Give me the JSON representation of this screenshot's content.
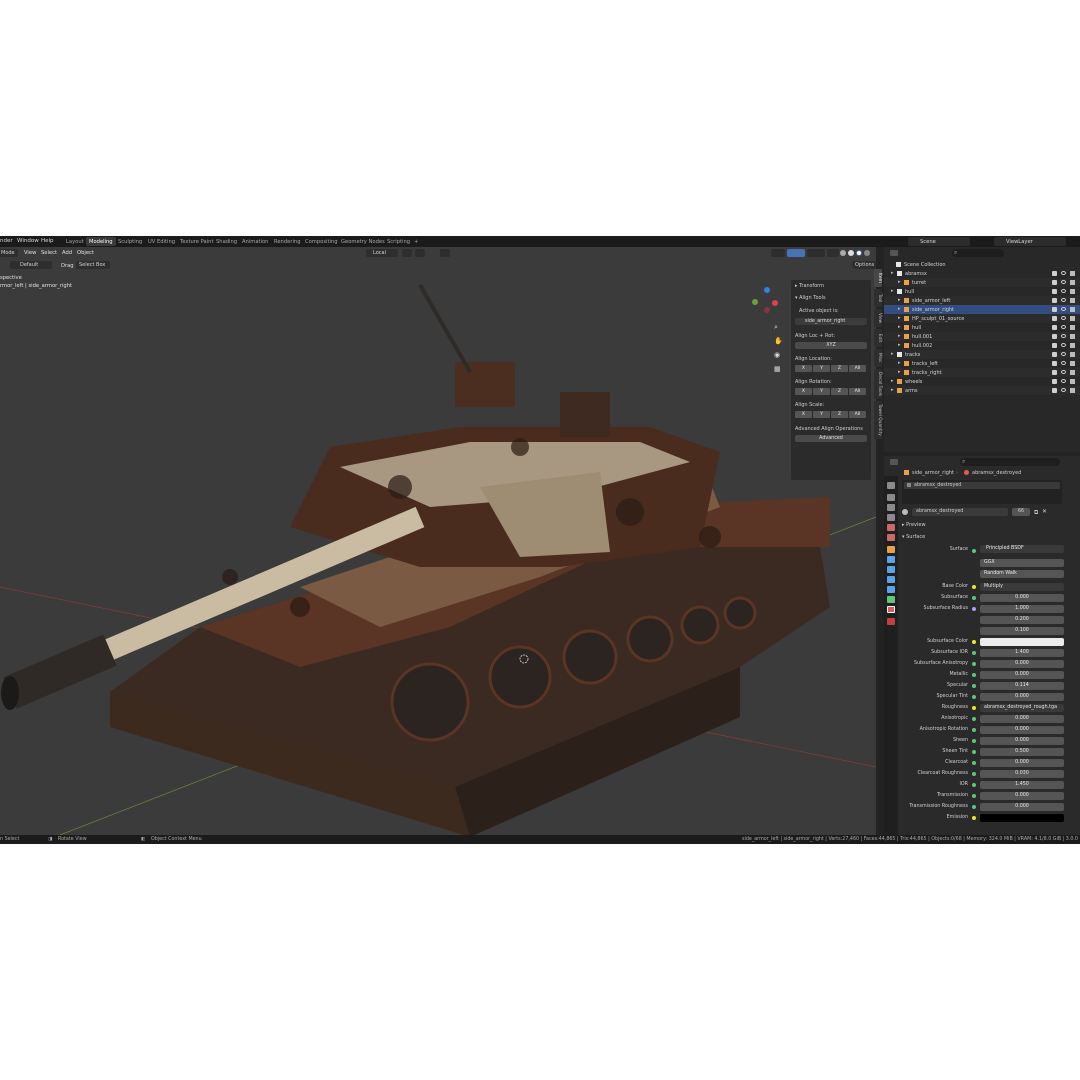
{
  "menu": [
    "nder",
    "Window",
    "Help"
  ],
  "workspaces": [
    "Layout",
    "Modeling",
    "Sculpting",
    "UV Editing",
    "Texture Paint",
    "Shading",
    "Animation",
    "Rendering",
    "Compositing",
    "Geometry Nodes",
    "Scripting",
    "+"
  ],
  "active_workspace": "Modeling",
  "scene": "Scene",
  "view_layer": "ViewLayer",
  "viewport_header": {
    "mode": "Mode",
    "menus": [
      "View",
      "Select",
      "Add",
      "Object"
    ],
    "orientation": "Default",
    "drag_label": "Drag",
    "drag_value": "Select Box",
    "pivot": "Local",
    "options": "Options"
  },
  "viewport_overlay": {
    "view_name": "spective",
    "object_info": "rmor_left | side_armor_right"
  },
  "npanel": {
    "transform": "Transform",
    "align_tools": "Align Tools",
    "active_object_is": "Active object is:",
    "active_object": "side_armor_right",
    "align_loc_rot": "Align Loc + Rot:",
    "xyz": "XYZ",
    "align_location": "Align Location:",
    "align_rotation": "Align Rotation:",
    "align_scale": "Align Scale:",
    "axes": [
      "X",
      "Y",
      "Z",
      "All"
    ],
    "advanced_ops": "Advanced Align Operations",
    "advanced": "Advanced"
  },
  "side_tabs": [
    "Item",
    "Tool",
    "View",
    "Edit",
    "Misc",
    "Decal Tools",
    "Towel Quantity"
  ],
  "outliner": {
    "root": "Scene Collection",
    "rows": [
      {
        "label": "abramsx",
        "indent": 1,
        "type": "collection"
      },
      {
        "label": "turret",
        "indent": 2,
        "type": "object"
      },
      {
        "label": "hull",
        "indent": 1,
        "type": "collection"
      },
      {
        "label": "side_armor_left",
        "indent": 2,
        "type": "object"
      },
      {
        "label": "side_armor_right",
        "indent": 2,
        "type": "object"
      },
      {
        "label": "HP_sculpt_01_source",
        "indent": 2,
        "type": "object"
      },
      {
        "label": "hull",
        "indent": 2,
        "type": "object"
      },
      {
        "label": "hull.001",
        "indent": 2,
        "type": "object"
      },
      {
        "label": "hull.002",
        "indent": 2,
        "type": "object"
      },
      {
        "label": "tracks",
        "indent": 1,
        "type": "collection"
      },
      {
        "label": "tracks_left",
        "indent": 2,
        "type": "object"
      },
      {
        "label": "tracks_right",
        "indent": 2,
        "type": "object"
      },
      {
        "label": "wheels",
        "indent": 1,
        "type": "object"
      },
      {
        "label": "arms",
        "indent": 1,
        "type": "object"
      }
    ]
  },
  "properties": {
    "breadcrumb_object": "side_armor_right",
    "breadcrumb_material": "abramsx_destroyed",
    "material_slot": "abramsx_destroyed",
    "material_name": "abramsx_destroyed",
    "user_count": "66",
    "preview": "Preview",
    "surface_section": "Surface",
    "surface_label": "Surface",
    "surface_value": "Principled BSDF",
    "distribution": "GGX",
    "subsurface_method": "Random Walk",
    "params": [
      {
        "label": "Base Color",
        "value": "Multiply",
        "dot": "y",
        "fill": 0
      },
      {
        "label": "Subsurface",
        "value": "0.000",
        "dot": "g",
        "fill": 0
      },
      {
        "label": "Subsurface Radius",
        "value": "1.000",
        "dot": "b",
        "fill": 0
      },
      {
        "label": "",
        "value": "0.200",
        "dot": "",
        "fill": 0
      },
      {
        "label": "",
        "value": "0.100",
        "dot": "",
        "fill": 0
      },
      {
        "label": "Subsurface Color",
        "value": "",
        "dot": "y",
        "fill": 0,
        "swatch": "#ececec"
      },
      {
        "label": "Subsurface IOR",
        "value": "1.400",
        "dot": "g",
        "fill": 0.12
      },
      {
        "label": "Subsurface Anisotropy",
        "value": "0.000",
        "dot": "g",
        "fill": 0
      },
      {
        "label": "Metallic",
        "value": "0.000",
        "dot": "g",
        "fill": 0
      },
      {
        "label": "Specular",
        "value": "0.114",
        "dot": "g",
        "fill": 0.1
      },
      {
        "label": "Specular Tint",
        "value": "0.000",
        "dot": "g",
        "fill": 0
      },
      {
        "label": "Roughness",
        "value": "abramsx_destroyed_rough.tga",
        "dot": "y",
        "fill": 0
      },
      {
        "label": "Anisotropic",
        "value": "0.000",
        "dot": "g",
        "fill": 0
      },
      {
        "label": "Anisotropic Rotation",
        "value": "0.000",
        "dot": "g",
        "fill": 0
      },
      {
        "label": "Sheen",
        "value": "0.000",
        "dot": "g",
        "fill": 0
      },
      {
        "label": "Sheen Tint",
        "value": "0.500",
        "dot": "g",
        "fill": 0.5
      },
      {
        "label": "Clearcoat",
        "value": "0.000",
        "dot": "g",
        "fill": 0
      },
      {
        "label": "Clearcoat Roughness",
        "value": "0.030",
        "dot": "g",
        "fill": 0.03
      },
      {
        "label": "IOR",
        "value": "1.450",
        "dot": "g",
        "fill": 0
      },
      {
        "label": "Transmission",
        "value": "0.000",
        "dot": "g",
        "fill": 0
      },
      {
        "label": "Transmission Roughness",
        "value": "0.000",
        "dot": "g",
        "fill": 0
      },
      {
        "label": "Emission",
        "value": "",
        "dot": "y",
        "fill": 0,
        "swatch": "#000000"
      }
    ]
  },
  "statusbar": {
    "left1": "n Select",
    "left2": "Rotate View",
    "left3": "Object Context Menu",
    "right": "side_armor_left | side_armor_right | Verts:27,460 | Faces:44,865 | Tris:44,865 | Objects:0/68 | Memory: 324.0 MiB | VRAM: 4.1/8.0 GiB | 3.0.0"
  },
  "colors": {
    "accent": "#4772b3",
    "selection": "#334d80",
    "background": "#3b3b3b",
    "tank_rust": "#5a3424",
    "tank_tan": "#b9ab93"
  }
}
